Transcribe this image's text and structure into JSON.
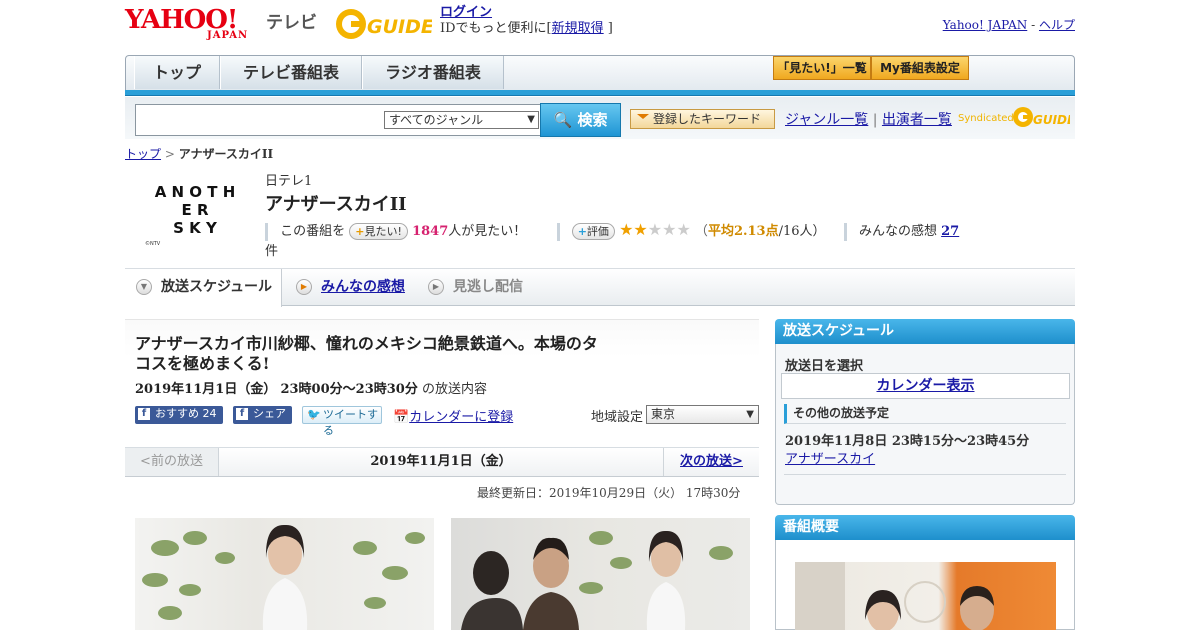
{
  "header": {
    "yahoo_logo_text": "YAHOO!",
    "yahoo_logo_sub": "JAPAN",
    "tv_label": "テレビ",
    "gguide_logo_text": "G-GUIDE",
    "login_link": "ログイン",
    "login_prompt_prefix": "IDでもっと便利に[",
    "register_link": "新規取得",
    "login_prompt_suffix": "]",
    "yahoo_japan_link": "Yahoo! JAPAN",
    "separator": "-",
    "help_link": "ヘルプ"
  },
  "nav": {
    "tabs": [
      {
        "label": "トップ"
      },
      {
        "label": "テレビ番組表"
      },
      {
        "label": "ラジオ番組表"
      }
    ],
    "want_list_button": "「見たい!」一覧",
    "my_schedule_button": "My番組表設定"
  },
  "search": {
    "input_value": "",
    "genre_selected": "すべてのジャンル",
    "search_button": "検索",
    "keyword_button": "登録したキーワード",
    "genre_list_link": "ジャンル一覧",
    "divider": "|",
    "performer_list_link": "出演者一覧",
    "syndicated_label": "Syndicated"
  },
  "breadcrumb": {
    "home": "トップ",
    "separator": ">",
    "current": "アナザースカイII"
  },
  "program": {
    "logo_lines": [
      "A N O T H",
      "E R",
      "S K Y"
    ],
    "logo_copyright": "©NTV",
    "channel": "日テレ1",
    "title": "アナザースカイII",
    "want_prefix": "この番組を",
    "want_button": "見たい!",
    "want_count": "1847",
    "want_suffix": "人が見たい！",
    "rating_button": "評価",
    "rating_stars": 2,
    "rating_max": 5,
    "rating_prefix": "（",
    "rating_avg_label": "平均2.13点",
    "rating_count": "/16人）",
    "reviews_prefix": "みんなの感想",
    "reviews_count": "27",
    "reviews_suffix": "件"
  },
  "tabs": {
    "schedule": "放送スケジュール",
    "reviews": "みんなの感想",
    "vod": "見逃し配信"
  },
  "episode": {
    "title": "アナザースカイ市川紗椰、憧れのメキシコ絶景鉄道へ。本場のタコスを極めまくる!",
    "date": "2019年11月1日（金）",
    "time": "23時00分～23時30分",
    "time_suffix": "の放送内容",
    "recommend_label": "おすすめ",
    "recommend_count": "24",
    "share_label": "シェア",
    "tweet_label": "ツイートする",
    "calendar_link": "カレンダーに登録",
    "region_label": "地域設定",
    "region_value": "東京"
  },
  "pager": {
    "prev": "<前の放送",
    "current": "2019年11月1日（金）",
    "next": "次の放送>"
  },
  "updated": "最終更新日：2019年10月29日（火） 17時30分",
  "sidebar": {
    "schedule_title": "放送スケジュール",
    "select_date_label": "放送日を選択",
    "calendar_button": "カレンダー表示",
    "other_heading": "その他の放送予定",
    "other_time": "2019年11月8日 23時15分～23時45分",
    "other_link": "アナザースカイ",
    "overview_title": "番組概要"
  },
  "colors": {
    "accent_blue": "#2a9fd8",
    "link": "#1a1aa6",
    "want_count_pink": "#d6226f",
    "rating_orange": "#d08a00",
    "yahoo_red": "#e60012"
  }
}
